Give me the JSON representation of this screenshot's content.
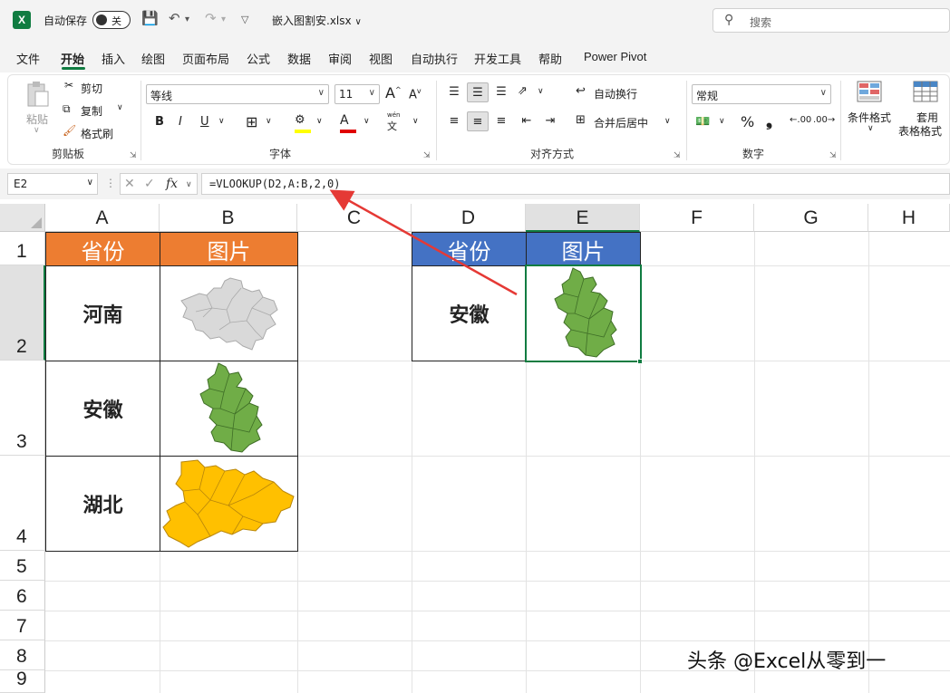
{
  "titlebar": {
    "app_icon": "X",
    "autosave_label": "自动保存",
    "autosave_state": "关",
    "filename": "嵌入图割安.xlsx",
    "search_placeholder": "搜索"
  },
  "menu": {
    "tabs": [
      "文件",
      "开始",
      "插入",
      "绘图",
      "页面布局",
      "公式",
      "数据",
      "审阅",
      "视图",
      "自动执行",
      "开发工具",
      "帮助",
      "Power Pivot"
    ],
    "active_tab": "开始"
  },
  "ribbon": {
    "clipboard": {
      "paste": "粘贴",
      "cut": "剪切",
      "copy": "复制",
      "format_painter": "格式刷",
      "label": "剪贴板"
    },
    "font": {
      "font_name": "等线",
      "font_size": "11",
      "increase": "A",
      "decrease": "A",
      "bold": "B",
      "italic": "I",
      "underline": "U",
      "label": "字体",
      "wen": "wén",
      "wen_char": "文"
    },
    "alignment": {
      "wrap_text": "自动换行",
      "merge_center": "合并后居中",
      "label": "对齐方式"
    },
    "number": {
      "format": "常规",
      "percent": "%",
      "comma": "❟",
      "inc_decimal": ".00",
      "dec_decimal": ".00",
      "label": "数字"
    },
    "styles": {
      "conditional": "条件格式",
      "table_format_line1": "套用",
      "table_format_line2": "表格格式"
    }
  },
  "formulabar": {
    "namebox": "E2",
    "formula": "=VLOOKUP(D2,A:B,2,0)"
  },
  "grid": {
    "columns": [
      "A",
      "B",
      "C",
      "D",
      "E",
      "F",
      "G",
      "H"
    ],
    "rows": [
      "1",
      "2",
      "3",
      "4",
      "5",
      "6",
      "7",
      "8",
      "9"
    ],
    "selected_column": "E",
    "selected_row": "2",
    "table1": {
      "headers": [
        "省份",
        "图片"
      ],
      "rows": [
        "河南",
        "安徽",
        "湖北"
      ]
    },
    "table2": {
      "headers": [
        "省份",
        "图片"
      ],
      "rows": [
        "安徽"
      ]
    }
  },
  "map_colors": {
    "henan": "#d9d9d9",
    "anhui": "#70ad47",
    "hubei": "#ffc000"
  },
  "watermark": "头条 @Excel从零到一"
}
